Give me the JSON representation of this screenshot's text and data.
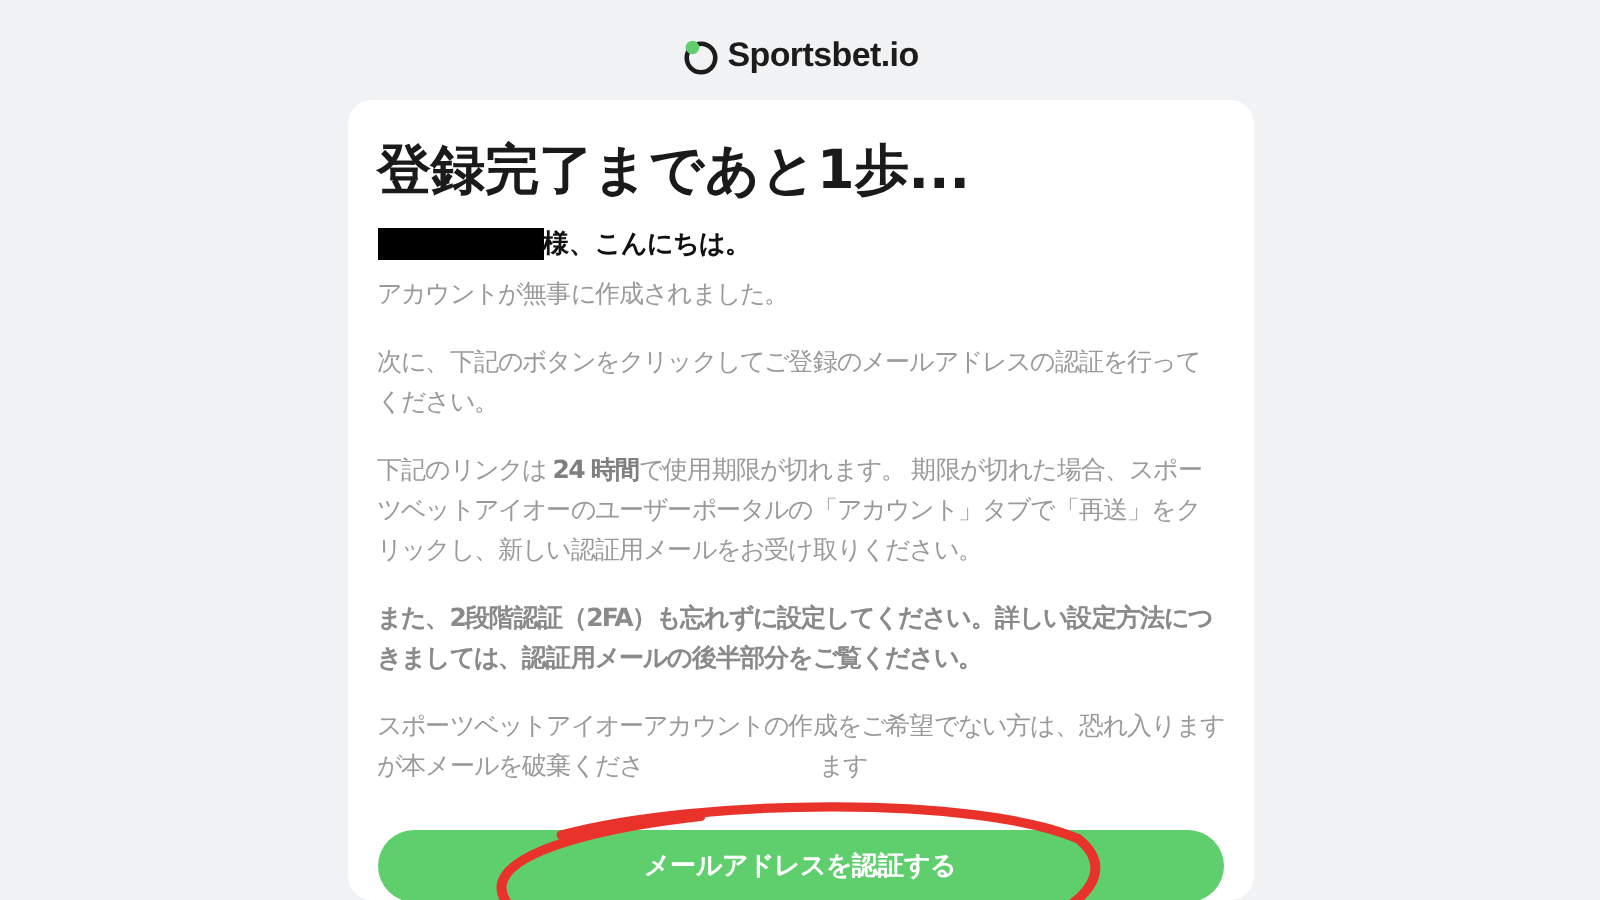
{
  "header": {
    "logo_text": "Sportsbet.io"
  },
  "email": {
    "title": "登録完了まであと1歩...",
    "greeting": {
      "name_redacted": true,
      "text": "様、こんにちは。"
    },
    "paragraphs": [
      {
        "kind": "plain",
        "text": "アカウントが無事に作成されました。"
      },
      {
        "kind": "plain",
        "text": "次に、下記のボタンをクリックしてご登録のメールアドレスの認証を行ってください。"
      },
      {
        "kind": "plain",
        "text": "下記のリンクは **24 時間**で使用期限が切れます。 期限が切れた場合、スポーツベットアイオーのユーザーポータルの「アカウント」タブで「再送」をクリックし、新しい認証用メールをお受け取りください。"
      },
      {
        "kind": "bold",
        "text": "また、2段階認証（2FA）も忘れずに設定してください。詳しい設定方法につきましては、認証用メールの後半部分をご覧ください。"
      },
      {
        "kind": "covered",
        "text": "スポーツベットアイオーアカウントの作成をご希望でない方は、恐れ入ります",
        "line_2": "が本メールを破棄くださ",
        "tail": "ます"
      }
    ],
    "button": {
      "label": "メールアドレスを認証する",
      "circled": true
    }
  }
}
